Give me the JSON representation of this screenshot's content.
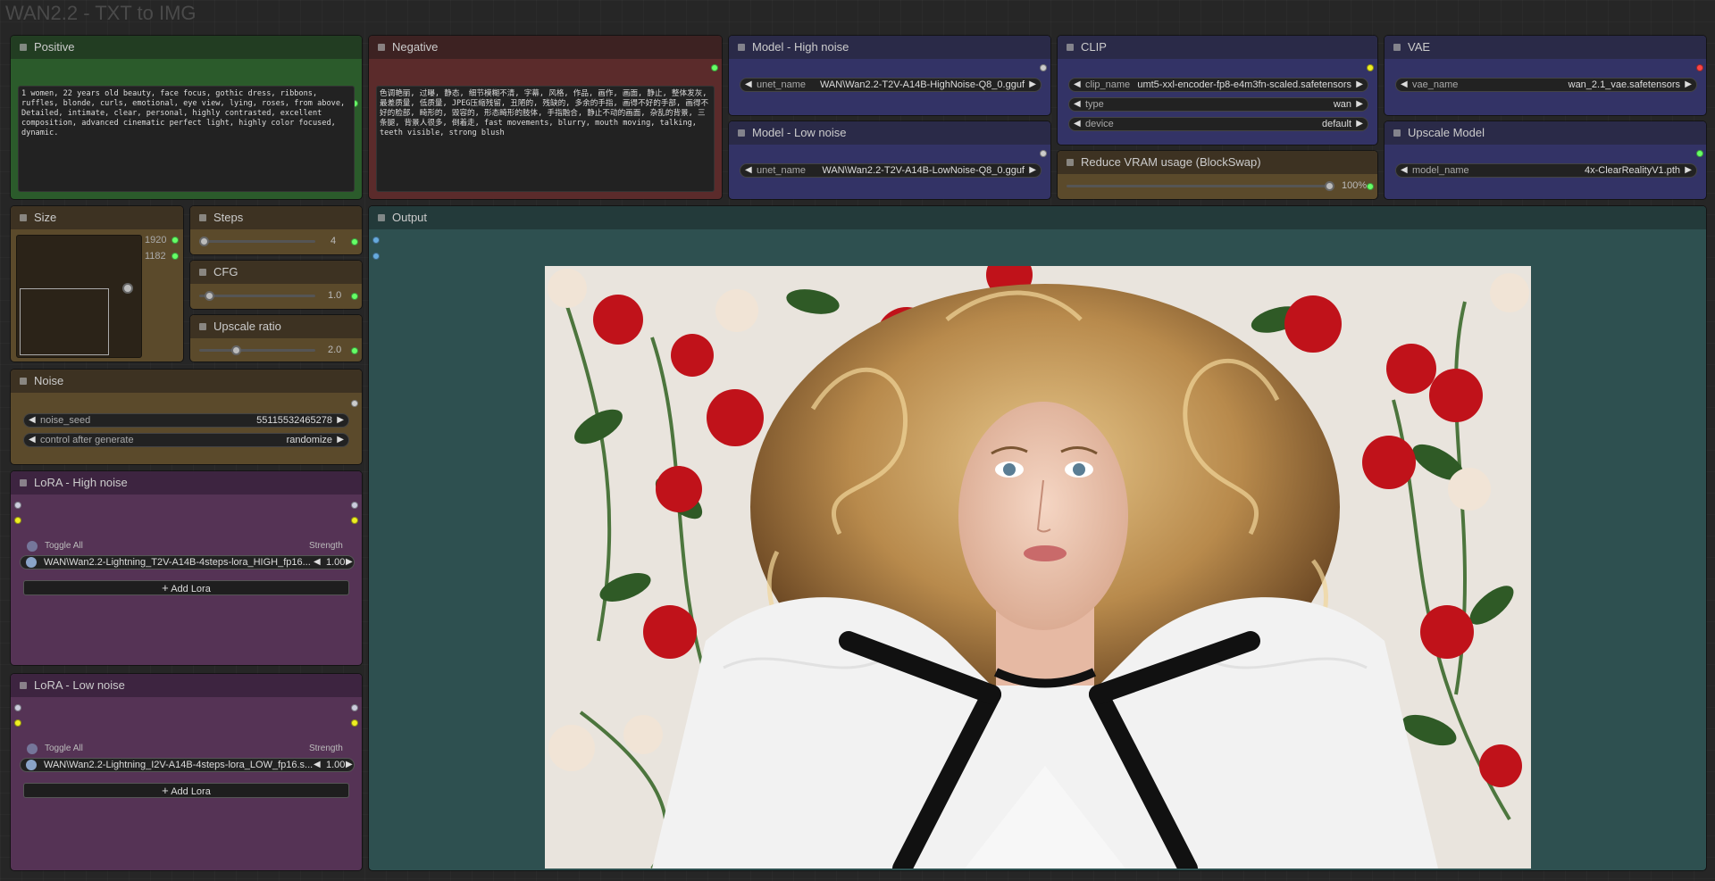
{
  "group_title": "WAN2.2 - TXT to IMG",
  "colors": {
    "positive_body": "#2b5b2b",
    "positive_header": "#223d22",
    "negative_body": "#5b2b2b",
    "negative_header": "#3d2222",
    "model_body": "#333366",
    "model_header": "#2a2a48",
    "brown_body": "#5b4a2b",
    "brown_header": "#3d3222",
    "purple_body": "#553355",
    "purple_header": "#3d2440",
    "output_body": "#2e5050",
    "output_header": "#233a3a"
  },
  "positive": {
    "title": "Positive",
    "text": "1 women, 22 years old beauty, face focus, gothic dress, ribbons, ruffles, blonde, curls, emotional, eye view, lying, roses, from above, Detailed, intimate, clear, personal, highly contrasted, excellent composition, advanced cinematic perfect light, highly color focused, dynamic."
  },
  "negative": {
    "title": "Negative",
    "text": "色调艳丽, 过曝, 静态, 细节模糊不清, 字幕, 风格, 作品, 画作, 画面, 静止, 整体发灰, 最差质量, 低质量, JPEG压缩残留, 丑陋的, 残缺的, 多余的手指, 画得不好的手部, 画得不好的脸部, 畸形的, 毁容的, 形态畸形的肢体, 手指融合, 静止不动的画面, 杂乱的背景, 三条腿, 背景人很多, 倒着走, fast movements, blurry, mouth moving, talking, teeth visible, strong blush"
  },
  "model_high": {
    "title": "Model - High noise",
    "label": "unet_name",
    "value": "WAN\\Wan2.2-T2V-A14B-HighNoise-Q8_0.gguf"
  },
  "model_low": {
    "title": "Model - Low noise",
    "label": "unet_name",
    "value": "WAN\\Wan2.2-T2V-A14B-LowNoise-Q8_0.gguf"
  },
  "clip": {
    "title": "CLIP",
    "widgets": [
      {
        "label": "clip_name",
        "value": "umt5-xxl-encoder-fp8-e4m3fn-scaled.safetensors"
      },
      {
        "label": "type",
        "value": "wan"
      },
      {
        "label": "device",
        "value": "default"
      }
    ]
  },
  "blockswap": {
    "title": "Reduce VRAM usage (BlockSwap)",
    "value": "100%",
    "fraction": 1.0
  },
  "vae": {
    "title": "VAE",
    "label": "vae_name",
    "value": "wan_2.1_vae.safetensors"
  },
  "upscale_model": {
    "title": "Upscale Model",
    "label": "model_name",
    "value": "4x-ClearRealityV1.pth"
  },
  "size": {
    "title": "Size",
    "width": "1920",
    "height": "1182"
  },
  "steps": {
    "title": "Steps",
    "value": "4",
    "fraction": 0.0
  },
  "cfg": {
    "title": "CFG",
    "value": "1.0",
    "fraction": 0.05
  },
  "upscale_ratio": {
    "title": "Upscale ratio",
    "value": "2.0",
    "fraction": 0.35
  },
  "noise": {
    "title": "Noise",
    "widgets": [
      {
        "label": "noise_seed",
        "value": "55115532465278"
      },
      {
        "label": "control after generate",
        "value": "randomize"
      }
    ]
  },
  "lora_high": {
    "title": "LoRA - High noise",
    "toggle_all": "Toggle All",
    "strength_label": "Strength",
    "lora_name": "WAN\\Wan2.2-Lightning_T2V-A14B-4steps-lora_HIGH_fp16...",
    "strength": "1.00",
    "add_label": "Add Lora"
  },
  "lora_low": {
    "title": "LoRA - Low noise",
    "toggle_all": "Toggle All",
    "strength_label": "Strength",
    "lora_name": "WAN\\Wan2.2-Lightning_I2V-A14B-4steps-lora_LOW_fp16.s...",
    "strength": "1.00",
    "add_label": "Add Lora"
  },
  "output": {
    "title": "Output"
  },
  "icons": {
    "arrow_left": "◀",
    "arrow_right": "▶",
    "plus": "+"
  }
}
